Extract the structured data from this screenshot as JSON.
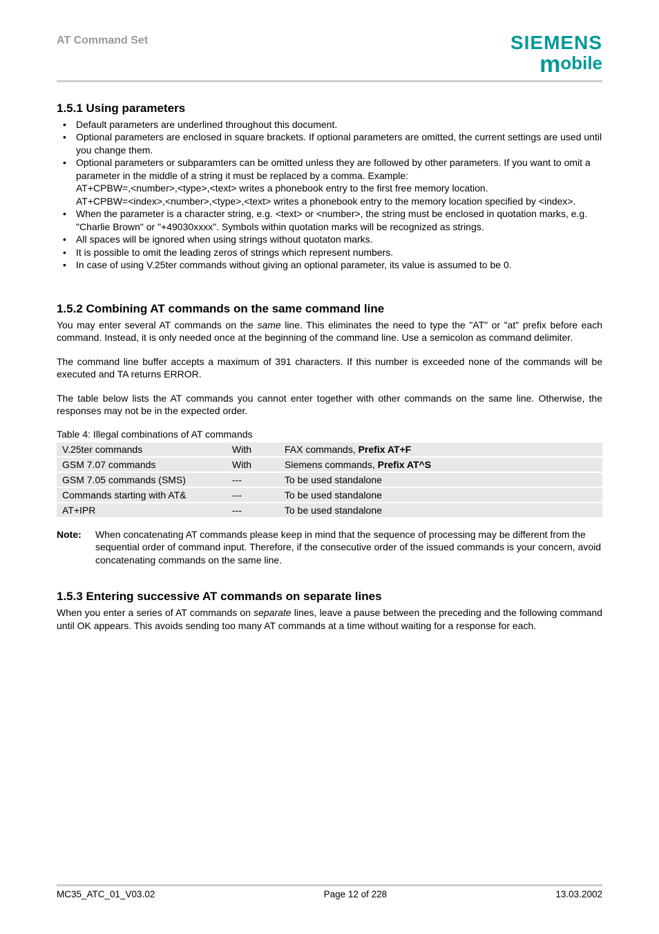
{
  "header": {
    "title": "AT Command Set",
    "logo_top": "SIEMENS",
    "logo_bottom_m": "m",
    "logo_bottom_rest": "obile"
  },
  "s1": {
    "heading": "1.5.1  Using parameters",
    "bullets": [
      "Default parameters are underlined throughout this document.",
      "Optional parameters are enclosed in square brackets. If optional parameters are omitted, the current settings are used until you change them.",
      "Optional parameters or subparamters can be omitted unless they are followed by other parameters. If you want to omit a parameter in the middle of a string it must be replaced by a comma. Example:",
      "When the parameter is a character string, e.g. <text> or <number>, the string must be enclosed in quotation marks, e.g. \"Charlie Brown\" or \"+49030xxxx\". Symbols within quotation marks will be recognized as strings.",
      "All spaces will be ignored when using strings without quotaton marks.",
      "It is possible to omit the leading zeros of strings which represent numbers.",
      "In case of using V.25ter commands without giving an optional parameter, its value is assumed to be 0."
    ],
    "example_lines": [
      "AT+CPBW=,<number>,<type>,<text> writes a phonebook entry to the first free memory location.",
      "AT+CPBW=<index>,<number>,<type>,<text> writes a phonebook entry to the memory location specified by <index>."
    ]
  },
  "s2": {
    "heading": "1.5.2  Combining AT commands on the same command line",
    "p1a": "You may enter several AT commands on the ",
    "p1_same": "same",
    "p1b": " line. This eliminates the need to type the \"AT\" or \"at\" prefix before each command. Instead, it is only needed once at the beginning of the command line. Use a semicolon as command delimiter.",
    "p2": "The command line buffer accepts a maximum of 391 characters. If this number is exceeded none of the commands will be executed and TA returns ERROR.",
    "p3": "The table below lists the AT commands you cannot enter together with other commands on the same line. Otherwise, the responses may not be in the expected order.",
    "table_caption": "Table 4: Illegal combinations of AT commands",
    "table": [
      {
        "c1": "V.25ter commands",
        "c2": "With",
        "c3a": "FAX commands, ",
        "c3b": "Prefix AT+F"
      },
      {
        "c1": "GSM 7.07 commands",
        "c2": "With",
        "c3a": "Siemens commands, ",
        "c3b": "Prefix AT^S"
      },
      {
        "c1": "GSM 7.05 commands (SMS)",
        "c2": "---",
        "c3a": "To be used standalone",
        "c3b": ""
      },
      {
        "c1": "Commands starting with AT&",
        "c2": "---",
        "c3a": "To be used standalone",
        "c3b": ""
      },
      {
        "c1": "AT+IPR",
        "c2": "---",
        "c3a": "To be used standalone",
        "c3b": ""
      }
    ],
    "note_label": "Note:",
    "note_text": "When concatenating AT commands please keep in mind that the sequence of processing may be different from the sequential order of command input. Therefore, if the consecutive order of the issued commands is your concern, avoid concatenating commands on the same line."
  },
  "s3": {
    "heading": "1.5.3  Entering successive AT commands on separate lines",
    "p1a": "When you enter a series of AT commands on ",
    "p1_sep": "separate",
    "p1b": " lines, leave a pause between the preceding and the following command until OK appears. This avoids sending too many AT commands at a time without waiting for a response for each."
  },
  "footer": {
    "left": "MC35_ATC_01_V03.02",
    "center": "Page 12 of 228",
    "right": "13.03.2002"
  }
}
